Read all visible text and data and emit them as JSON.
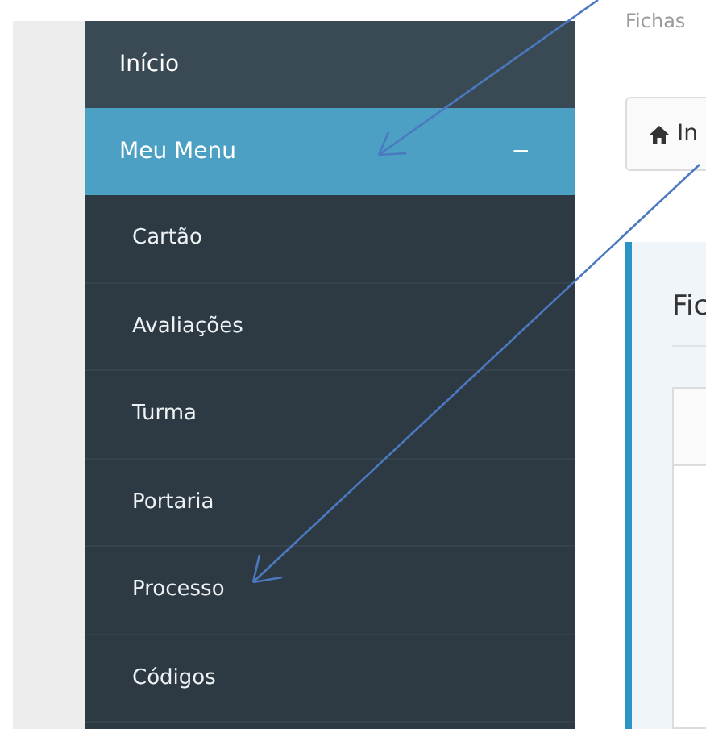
{
  "sidebar": {
    "items": [
      {
        "label": "Início",
        "selected": false
      },
      {
        "label": "Meu Menu",
        "selected": true,
        "toggle": "−",
        "children": [
          {
            "label": "Cartão",
            "selected": false
          },
          {
            "label": "Avaliações",
            "selected": false
          },
          {
            "label": "Turma",
            "selected": false
          },
          {
            "label": "Portaria",
            "selected": false
          },
          {
            "label": "Processo",
            "selected": false
          },
          {
            "label": "Códigos",
            "selected": false
          }
        ]
      }
    ]
  },
  "page": {
    "subtitle": "Fichas",
    "breadcrumb": "In",
    "panel": {
      "title": "Fic"
    }
  }
}
